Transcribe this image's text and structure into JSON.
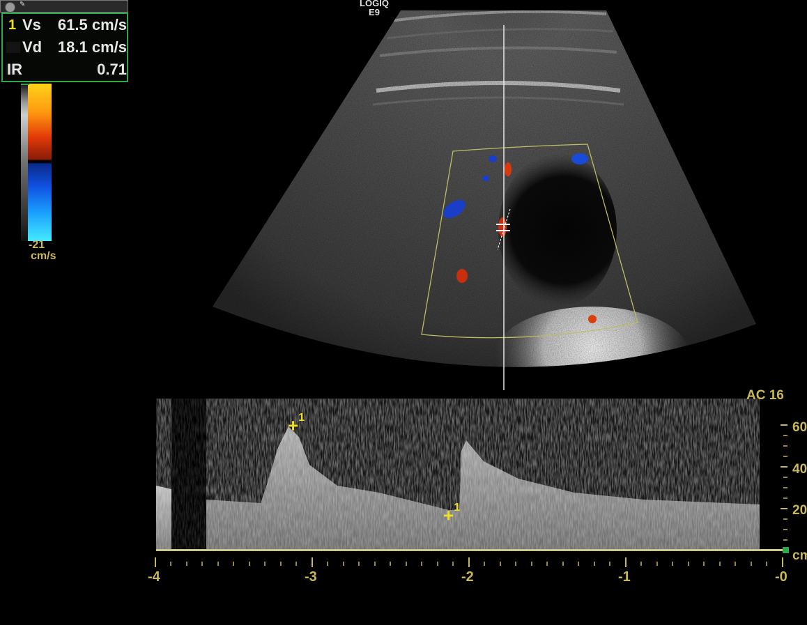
{
  "header": {
    "brand_line1": "LOGIQ",
    "brand_line2": "E9"
  },
  "measurements": {
    "selected_index": "1",
    "rows": [
      {
        "label": "Vs",
        "value": "61.5 cm/s"
      },
      {
        "label": "Vd",
        "value": "18.1 cm/s"
      },
      {
        "label": "IR",
        "value": "0.71"
      }
    ]
  },
  "colorbar": {
    "low_value": "-21",
    "unit": "cm/s"
  },
  "spectral": {
    "label": "AC 16",
    "velocity_ticks": [
      "60",
      "40",
      "20",
      "cm"
    ],
    "time_ticks": [
      "-4",
      "-3",
      "-2",
      "-1",
      "-0"
    ],
    "cursor_label": "1"
  },
  "colors": {
    "accent_yellow": "#c9b85a",
    "cursor_yellow": "#f0e020",
    "box_green": "#2ea84a"
  }
}
